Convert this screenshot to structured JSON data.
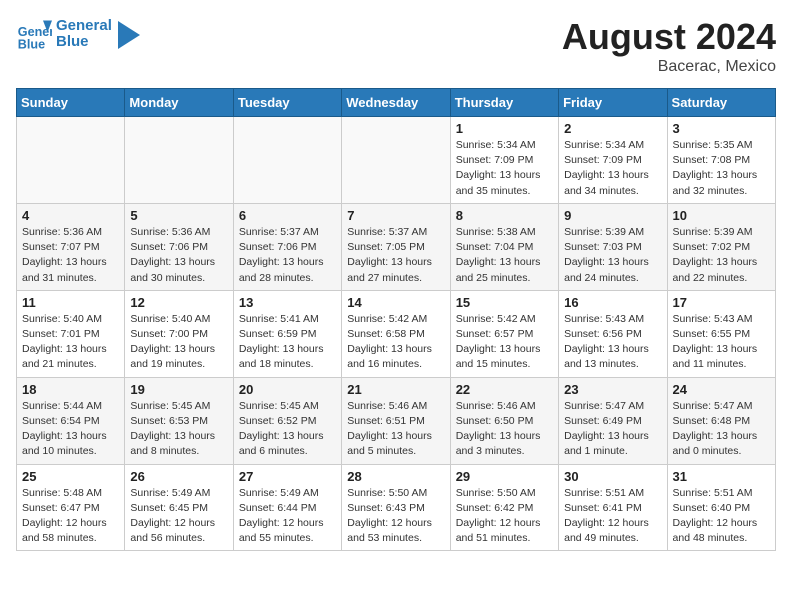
{
  "header": {
    "logo_line1": "General",
    "logo_line2": "Blue",
    "title": "August 2024",
    "subtitle": "Bacerac, Mexico"
  },
  "days_of_week": [
    "Sunday",
    "Monday",
    "Tuesday",
    "Wednesday",
    "Thursday",
    "Friday",
    "Saturday"
  ],
  "weeks": [
    {
      "days": [
        {
          "num": "",
          "info": ""
        },
        {
          "num": "",
          "info": ""
        },
        {
          "num": "",
          "info": ""
        },
        {
          "num": "",
          "info": ""
        },
        {
          "num": "1",
          "info": "Sunrise: 5:34 AM\nSunset: 7:09 PM\nDaylight: 13 hours\nand 35 minutes."
        },
        {
          "num": "2",
          "info": "Sunrise: 5:34 AM\nSunset: 7:09 PM\nDaylight: 13 hours\nand 34 minutes."
        },
        {
          "num": "3",
          "info": "Sunrise: 5:35 AM\nSunset: 7:08 PM\nDaylight: 13 hours\nand 32 minutes."
        }
      ]
    },
    {
      "days": [
        {
          "num": "4",
          "info": "Sunrise: 5:36 AM\nSunset: 7:07 PM\nDaylight: 13 hours\nand 31 minutes."
        },
        {
          "num": "5",
          "info": "Sunrise: 5:36 AM\nSunset: 7:06 PM\nDaylight: 13 hours\nand 30 minutes."
        },
        {
          "num": "6",
          "info": "Sunrise: 5:37 AM\nSunset: 7:06 PM\nDaylight: 13 hours\nand 28 minutes."
        },
        {
          "num": "7",
          "info": "Sunrise: 5:37 AM\nSunset: 7:05 PM\nDaylight: 13 hours\nand 27 minutes."
        },
        {
          "num": "8",
          "info": "Sunrise: 5:38 AM\nSunset: 7:04 PM\nDaylight: 13 hours\nand 25 minutes."
        },
        {
          "num": "9",
          "info": "Sunrise: 5:39 AM\nSunset: 7:03 PM\nDaylight: 13 hours\nand 24 minutes."
        },
        {
          "num": "10",
          "info": "Sunrise: 5:39 AM\nSunset: 7:02 PM\nDaylight: 13 hours\nand 22 minutes."
        }
      ]
    },
    {
      "days": [
        {
          "num": "11",
          "info": "Sunrise: 5:40 AM\nSunset: 7:01 PM\nDaylight: 13 hours\nand 21 minutes."
        },
        {
          "num": "12",
          "info": "Sunrise: 5:40 AM\nSunset: 7:00 PM\nDaylight: 13 hours\nand 19 minutes."
        },
        {
          "num": "13",
          "info": "Sunrise: 5:41 AM\nSunset: 6:59 PM\nDaylight: 13 hours\nand 18 minutes."
        },
        {
          "num": "14",
          "info": "Sunrise: 5:42 AM\nSunset: 6:58 PM\nDaylight: 13 hours\nand 16 minutes."
        },
        {
          "num": "15",
          "info": "Sunrise: 5:42 AM\nSunset: 6:57 PM\nDaylight: 13 hours\nand 15 minutes."
        },
        {
          "num": "16",
          "info": "Sunrise: 5:43 AM\nSunset: 6:56 PM\nDaylight: 13 hours\nand 13 minutes."
        },
        {
          "num": "17",
          "info": "Sunrise: 5:43 AM\nSunset: 6:55 PM\nDaylight: 13 hours\nand 11 minutes."
        }
      ]
    },
    {
      "days": [
        {
          "num": "18",
          "info": "Sunrise: 5:44 AM\nSunset: 6:54 PM\nDaylight: 13 hours\nand 10 minutes."
        },
        {
          "num": "19",
          "info": "Sunrise: 5:45 AM\nSunset: 6:53 PM\nDaylight: 13 hours\nand 8 minutes."
        },
        {
          "num": "20",
          "info": "Sunrise: 5:45 AM\nSunset: 6:52 PM\nDaylight: 13 hours\nand 6 minutes."
        },
        {
          "num": "21",
          "info": "Sunrise: 5:46 AM\nSunset: 6:51 PM\nDaylight: 13 hours\nand 5 minutes."
        },
        {
          "num": "22",
          "info": "Sunrise: 5:46 AM\nSunset: 6:50 PM\nDaylight: 13 hours\nand 3 minutes."
        },
        {
          "num": "23",
          "info": "Sunrise: 5:47 AM\nSunset: 6:49 PM\nDaylight: 13 hours\nand 1 minute."
        },
        {
          "num": "24",
          "info": "Sunrise: 5:47 AM\nSunset: 6:48 PM\nDaylight: 13 hours\nand 0 minutes."
        }
      ]
    },
    {
      "days": [
        {
          "num": "25",
          "info": "Sunrise: 5:48 AM\nSunset: 6:47 PM\nDaylight: 12 hours\nand 58 minutes."
        },
        {
          "num": "26",
          "info": "Sunrise: 5:49 AM\nSunset: 6:45 PM\nDaylight: 12 hours\nand 56 minutes."
        },
        {
          "num": "27",
          "info": "Sunrise: 5:49 AM\nSunset: 6:44 PM\nDaylight: 12 hours\nand 55 minutes."
        },
        {
          "num": "28",
          "info": "Sunrise: 5:50 AM\nSunset: 6:43 PM\nDaylight: 12 hours\nand 53 minutes."
        },
        {
          "num": "29",
          "info": "Sunrise: 5:50 AM\nSunset: 6:42 PM\nDaylight: 12 hours\nand 51 minutes."
        },
        {
          "num": "30",
          "info": "Sunrise: 5:51 AM\nSunset: 6:41 PM\nDaylight: 12 hours\nand 49 minutes."
        },
        {
          "num": "31",
          "info": "Sunrise: 5:51 AM\nSunset: 6:40 PM\nDaylight: 12 hours\nand 48 minutes."
        }
      ]
    }
  ]
}
